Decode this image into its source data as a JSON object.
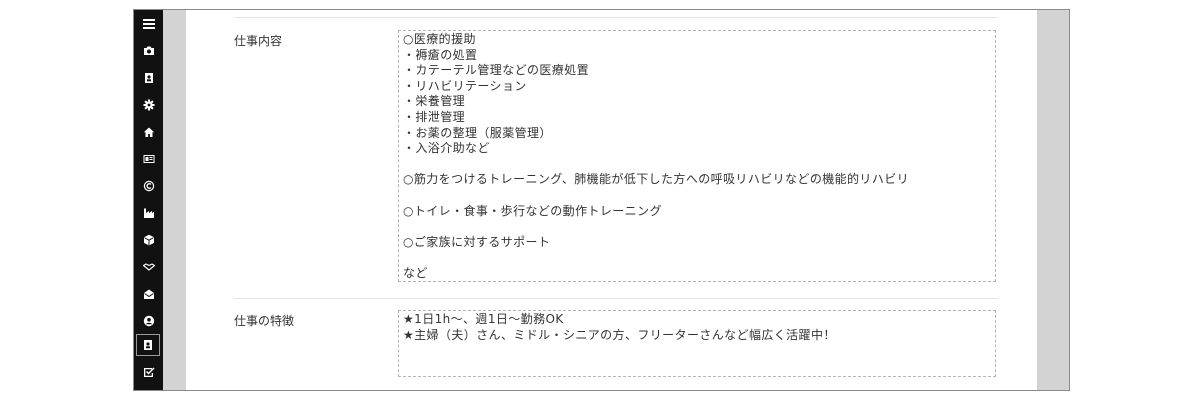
{
  "sidebar": {
    "items": [
      {
        "icon": "menu-icon"
      },
      {
        "icon": "camera-icon"
      },
      {
        "icon": "contact-book-icon"
      },
      {
        "icon": "gear-icon"
      },
      {
        "icon": "home-icon"
      },
      {
        "icon": "id-card-icon"
      },
      {
        "icon": "copyright-icon"
      },
      {
        "icon": "factory-icon"
      },
      {
        "icon": "cube-icon"
      },
      {
        "icon": "handshake-icon"
      },
      {
        "icon": "envelope-open-icon"
      },
      {
        "icon": "user-circle-icon"
      },
      {
        "icon": "contact-card-icon",
        "active": true
      },
      {
        "icon": "checkbox-icon"
      }
    ]
  },
  "sections": [
    {
      "label": "仕事内容",
      "lines": [
        "○医療的援助",
        "・褥瘡の処置",
        "・カテーテル管理などの医療処置",
        "・リハビリテーション",
        "・栄養管理",
        "・排泄管理",
        "・お薬の整理（服薬管理）",
        "・入浴介助など",
        "",
        "○筋力をつけるトレーニング、肺機能が低下した方への呼吸リハビリなどの機能的リハビリ",
        "",
        "○トイレ・食事・歩行などの動作トレーニング",
        "",
        "○ご家族に対するサポート",
        "",
        "など"
      ]
    },
    {
      "label": "仕事の特徴",
      "lines": [
        "★1日1h～、週1日～勤務OK",
        "★主婦（夫）さん、ミドル・シニアの方、フリーターさんなど幅広く活躍中！"
      ]
    }
  ]
}
